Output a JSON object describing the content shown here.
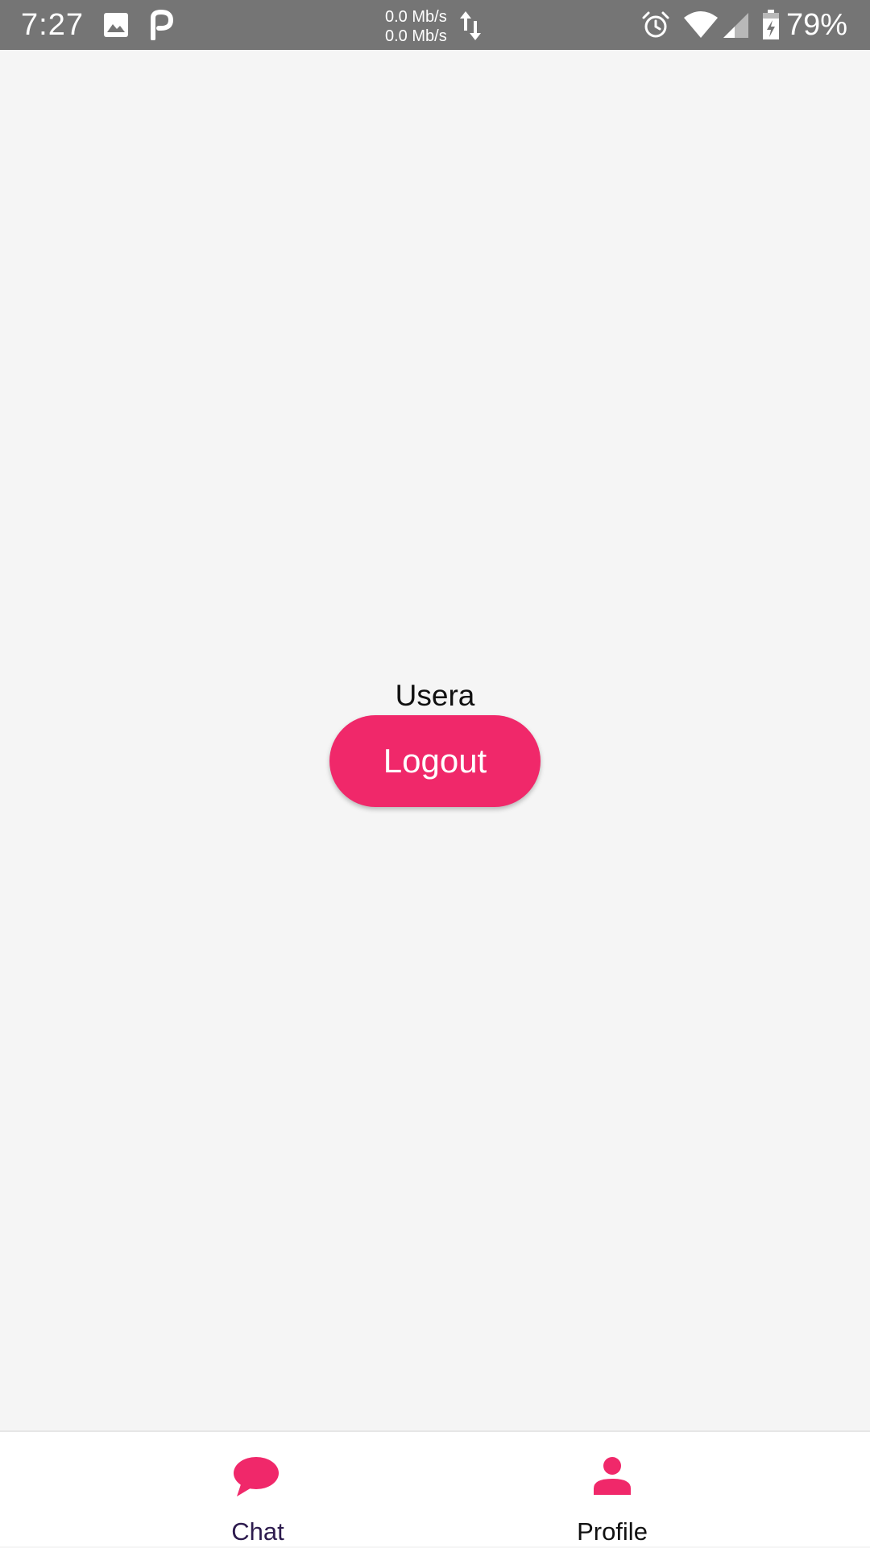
{
  "status_bar": {
    "time": "7:27",
    "net_up": "0.0 Mb/s",
    "net_down": "0.0 Mb/s",
    "battery": "79%",
    "icons": [
      "image-icon",
      "p-app-icon",
      "data-arrows-icon",
      "alarm-icon",
      "wifi-icon",
      "signal-icon",
      "battery-charging-icon"
    ]
  },
  "profile": {
    "username": "Usera",
    "logout_label": "Logout"
  },
  "bottom_nav": {
    "items": [
      {
        "label": "Chat",
        "icon": "chat-bubble-icon",
        "active": true
      },
      {
        "label": "Profile",
        "icon": "person-icon",
        "active": false
      }
    ]
  },
  "colors": {
    "accent": "#f0286a",
    "status_bar": "#757575",
    "background": "#f5f5f5",
    "nav_active_label": "#2d1b4e"
  }
}
